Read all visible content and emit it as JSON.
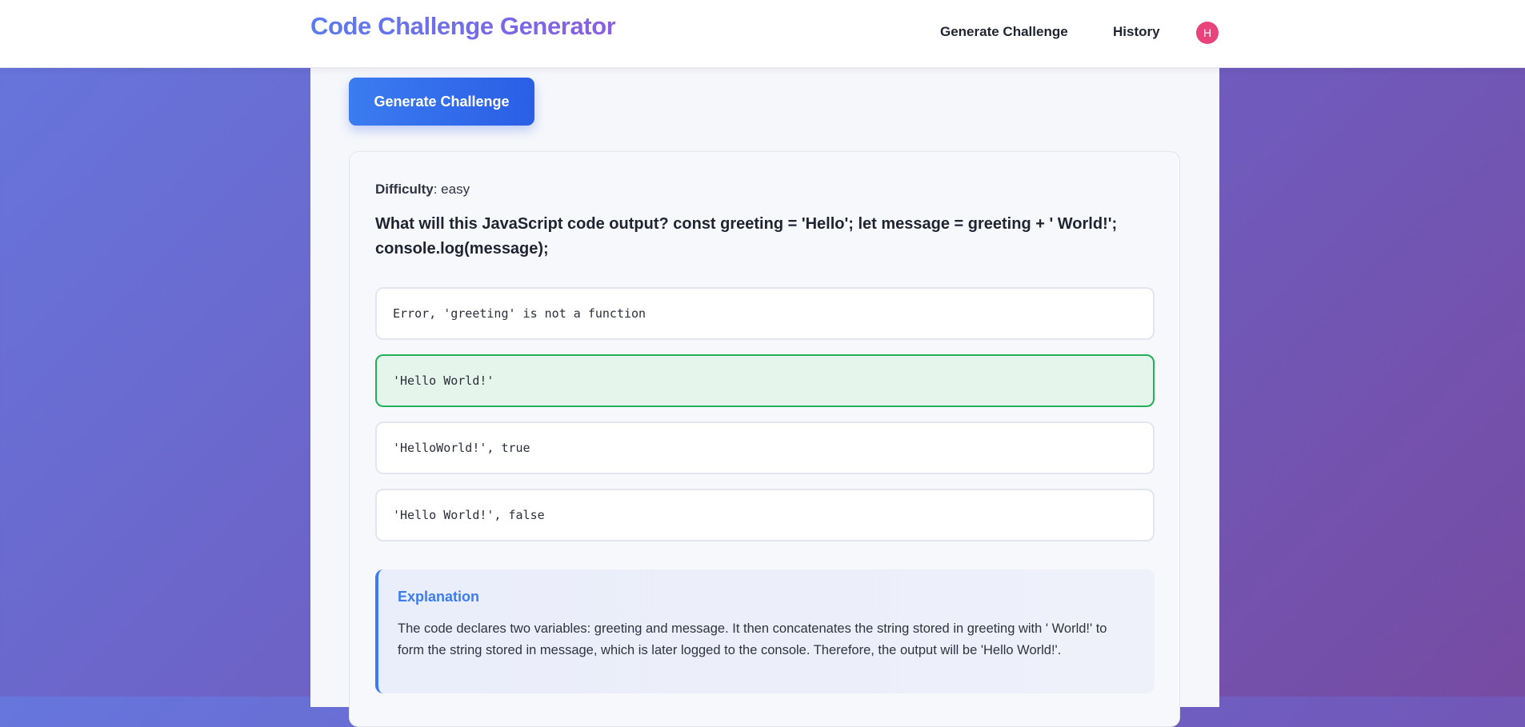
{
  "app": {
    "title": "Code Challenge Generator"
  },
  "nav": {
    "generate_label": "Generate Challenge",
    "history_label": "History",
    "avatar_initial": "H"
  },
  "main": {
    "generate_button_label": "Generate Challenge"
  },
  "challenge": {
    "difficulty_label": "Difficulty",
    "difficulty_value": ": easy",
    "question": "What will this JavaScript code output? const greeting = 'Hello'; let message = greeting + ' World!'; console.log(message);",
    "options": [
      {
        "text": "Error, 'greeting' is not a function",
        "state": "default"
      },
      {
        "text": "'Hello World!'",
        "state": "correct"
      },
      {
        "text": "'HelloWorld!', true",
        "state": "default"
      },
      {
        "text": "'Hello World!', false",
        "state": "default"
      }
    ],
    "explanation_title": "Explanation",
    "explanation_text": "The code declares two variables: greeting and message. It then concatenates the string stored in greeting with ' World!' to form the string stored in message, which is later logged to the console. Therefore, the output will be 'Hello World!'."
  },
  "colors": {
    "brand_gradient_start": "#5b7bf0",
    "brand_gradient_end": "#8a5fe0",
    "primary_button": "#2f6ae8",
    "correct_border": "#22b05b",
    "correct_background": "#e5f5ec",
    "avatar": "#e8437a",
    "explanation_accent": "#3b7cf0",
    "background_gradient_start": "#6676dd",
    "background_gradient_end": "#764ba2"
  }
}
